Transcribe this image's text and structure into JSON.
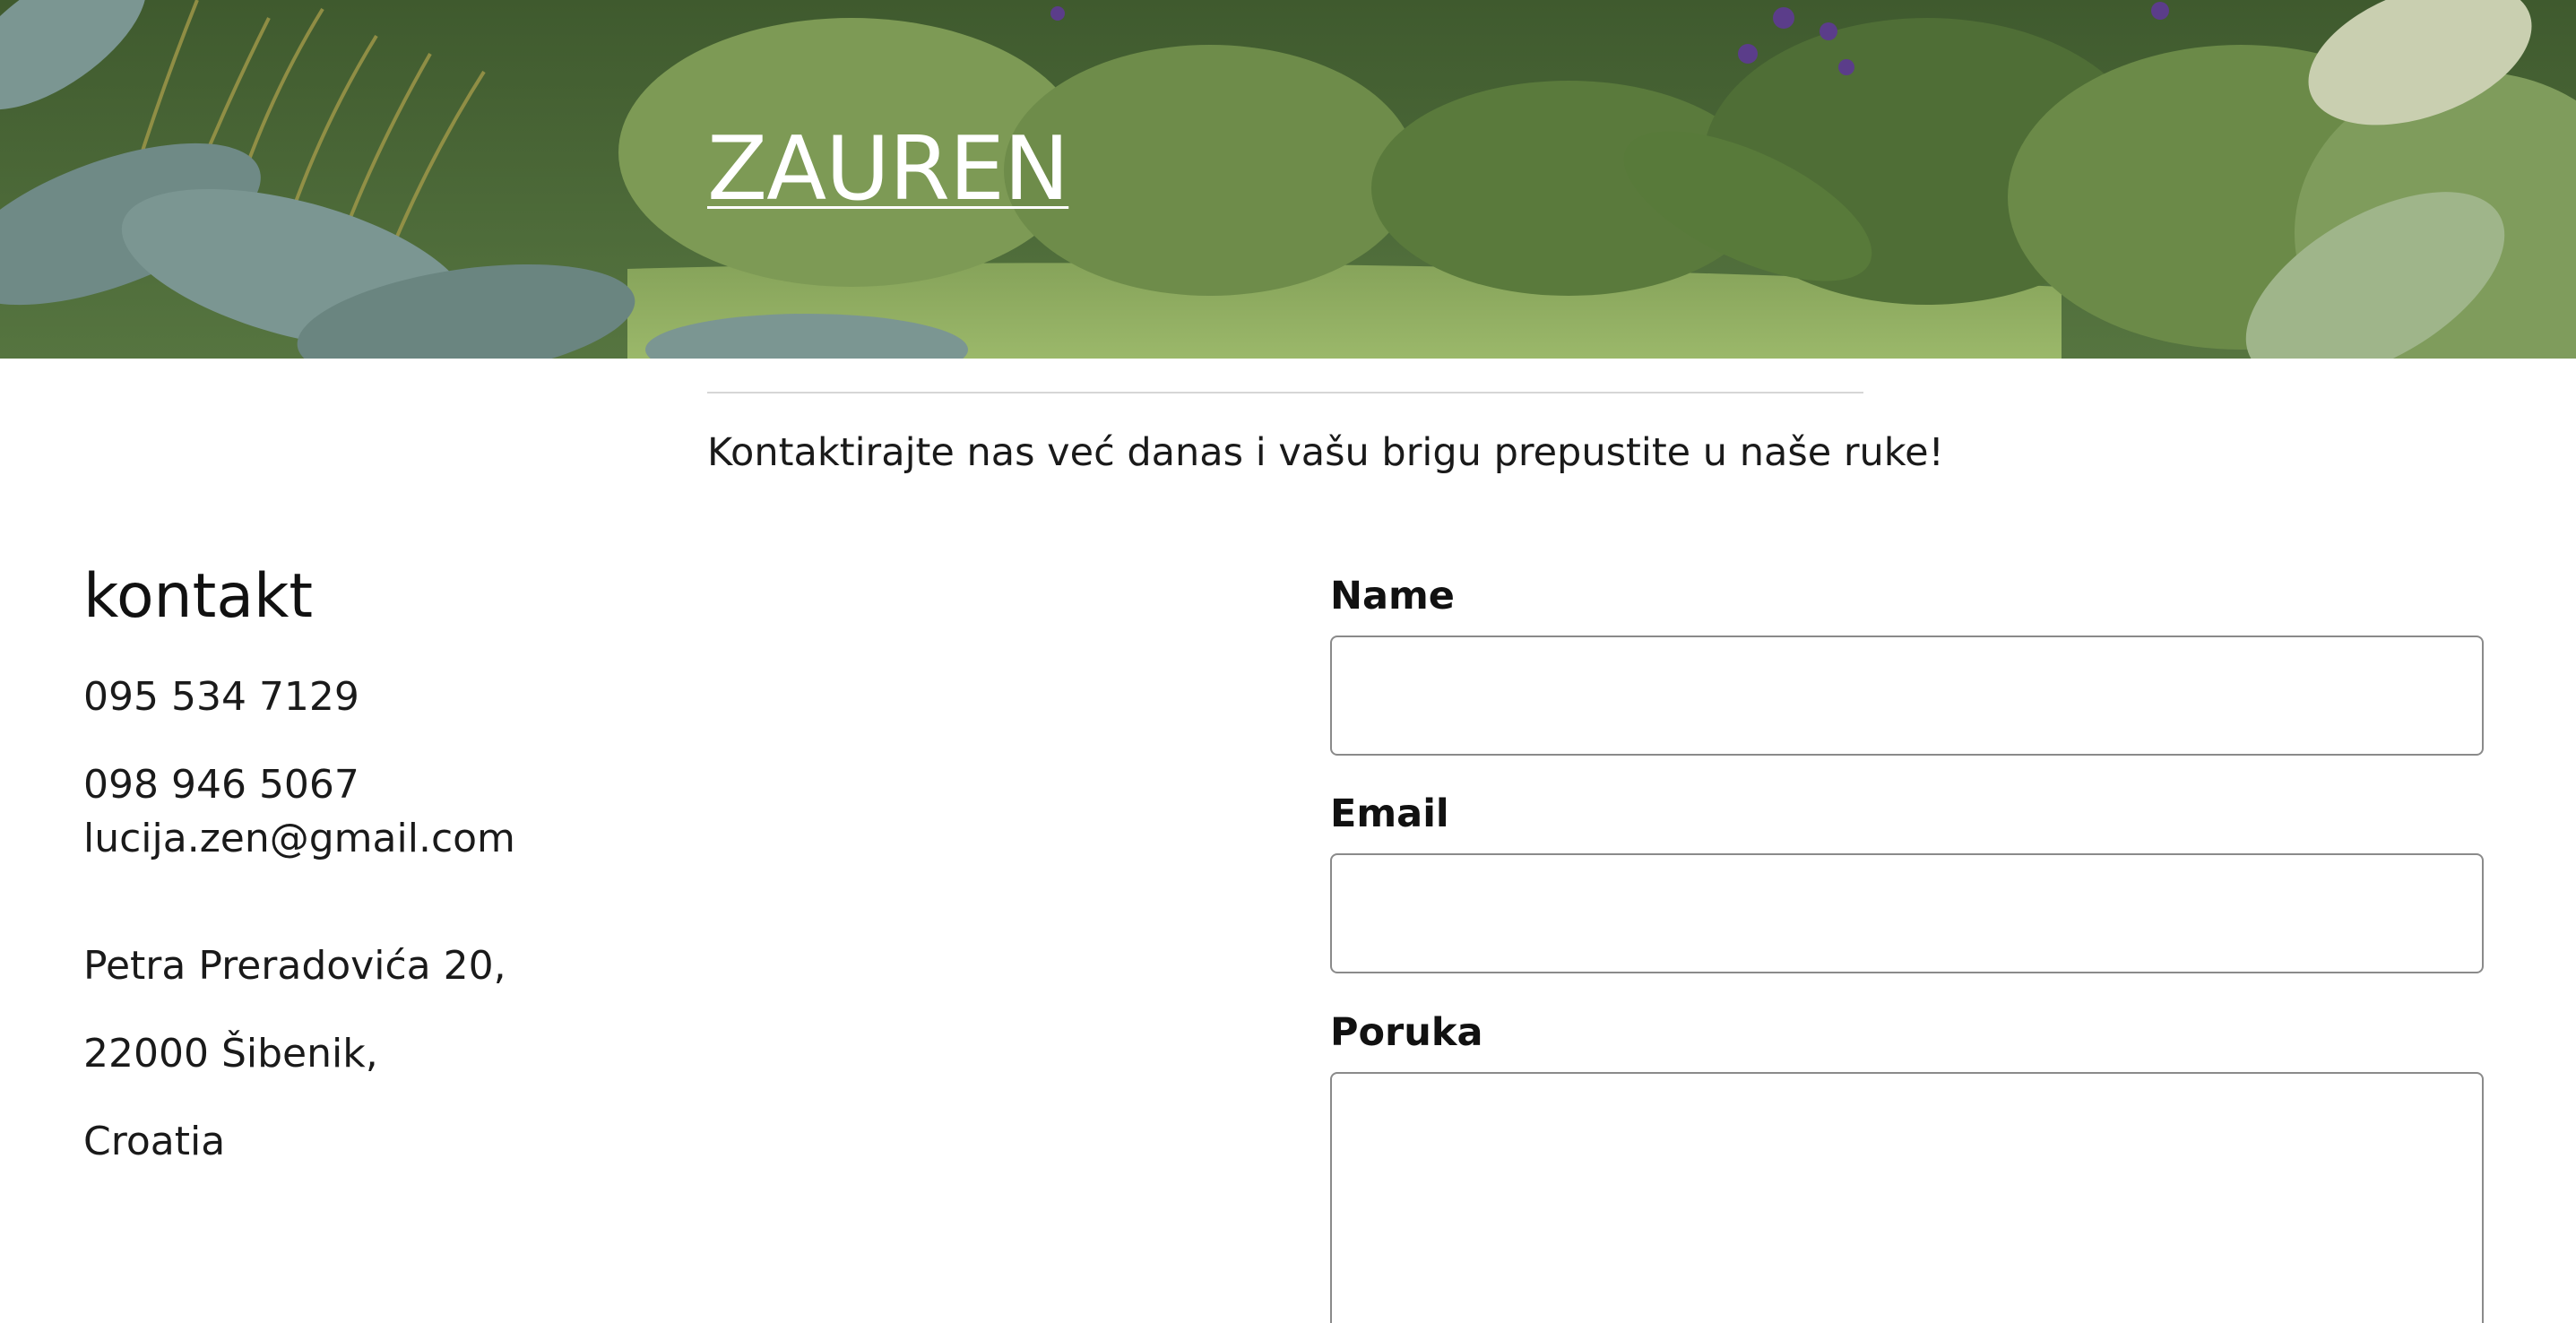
{
  "header": {
    "brand": "ZAUREN"
  },
  "tagline": "Kontaktirajte nas već danas i vašu brigu prepustite u naše ruke!",
  "contact": {
    "title": "kontakt",
    "phone_1": "095 534 7129",
    "phone_2": "098 946 5067",
    "email": "lucija.zen@gmail.com",
    "address_line_1": "Petra Preradovića 20,",
    "address_line_2": "22000 Šibenik,",
    "address_line_3": "Croatia"
  },
  "form": {
    "name_label": "Name",
    "name_value": "",
    "email_label": "Email",
    "email_value": "",
    "message_label": "Poruka",
    "message_value": ""
  },
  "colors": {
    "hero_green": "#5f7a45",
    "text": "#111111",
    "input_border": "#8a8a8a",
    "divider": "#d6d6d6"
  }
}
